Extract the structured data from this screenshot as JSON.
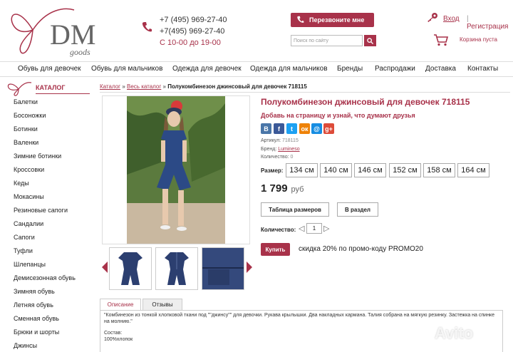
{
  "header": {
    "logo_text": "DM",
    "logo_sub": "goods",
    "phones": [
      "+7 (495) 969-27-40",
      "+7(495) 969-27-40"
    ],
    "hours": "С 10-00 до 19-00",
    "callback_label": "Перезвоните мне",
    "search_placeholder": "Поиск по сайту",
    "login_label": "Вход",
    "separator": "|",
    "register_label": "Регистрация",
    "cart_label": "Корзина пуста"
  },
  "nav": [
    "Обувь для девочек",
    "Обувь для мальчиков",
    "Одежда для девочек",
    "Одежда для мальчиков",
    "Бренды",
    "Распродажи",
    "Доставка",
    "Контакты"
  ],
  "sidebar": {
    "title": "КАТАЛОГ",
    "items": [
      "Балетки",
      "Босоножки",
      "Ботинки",
      "Валенки",
      "Зимние ботинки",
      "Кроссовки",
      "Кеды",
      "Мокасины",
      "Резиновые сапоги",
      "Сандалии",
      "Сапоги",
      "Туфли",
      "Шлепанцы",
      "Демисезонная обувь",
      "Зимняя обувь",
      "Летняя обувь",
      "Сменная обувь",
      "Брюки и шорты",
      "Джинсы"
    ]
  },
  "breadcrumb": {
    "items": [
      "Каталог",
      "Весь каталог"
    ],
    "sep": "»",
    "current": "Полукомбинезон джинсовый для девочек 718115"
  },
  "product": {
    "title": "Полукомбинезон джинсовый для девочек 718115",
    "share_text": "Добавь на страницу и узнай, что думают друзья",
    "social": [
      {
        "name": "vk",
        "letter": "В",
        "color": "#4a76a8"
      },
      {
        "name": "facebook",
        "letter": "f",
        "color": "#3b5998"
      },
      {
        "name": "twitter",
        "letter": "t",
        "color": "#1da1f2"
      },
      {
        "name": "odnoklassniki",
        "letter": "ок",
        "color": "#ee8208"
      },
      {
        "name": "mailru",
        "letter": "@",
        "color": "#168de2"
      },
      {
        "name": "googleplus",
        "letter": "g+",
        "color": "#dd4b39"
      }
    ],
    "article_label": "Артикул:",
    "article_value": "718115",
    "brand_label": "Бренд:",
    "brand_value": "Lumineso",
    "quantity_label": "Количество:",
    "quantity_value": "0",
    "size_label": "Размер:",
    "sizes": [
      "134 см",
      "140 см",
      "146 см",
      "152 см",
      "158 см",
      "164 см"
    ],
    "price": "1 799",
    "currency": "руб",
    "size_table_label": "Таблица размеров",
    "section_label": "В раздел",
    "qty_input_label": "Количество:",
    "qty_value": "1",
    "buy_label": "Купить",
    "promo_text": "скидка 20% по промо-коду PROMO20"
  },
  "tabs": [
    "Описание",
    "Отзывы"
  ],
  "description": "\"Комбинезон из тонкой хлопковой ткани под \"\"джинсу\"\" для девочки. Рукава крылышки. Два накладных кармана. Талия собрана на мягкую резинку. Застежка на спинке на молнию.\"",
  "composition_label": "Состав:",
  "composition_value": "100%хлопок",
  "watermark": "Avito",
  "colors": {
    "accent": "#a8324a"
  }
}
